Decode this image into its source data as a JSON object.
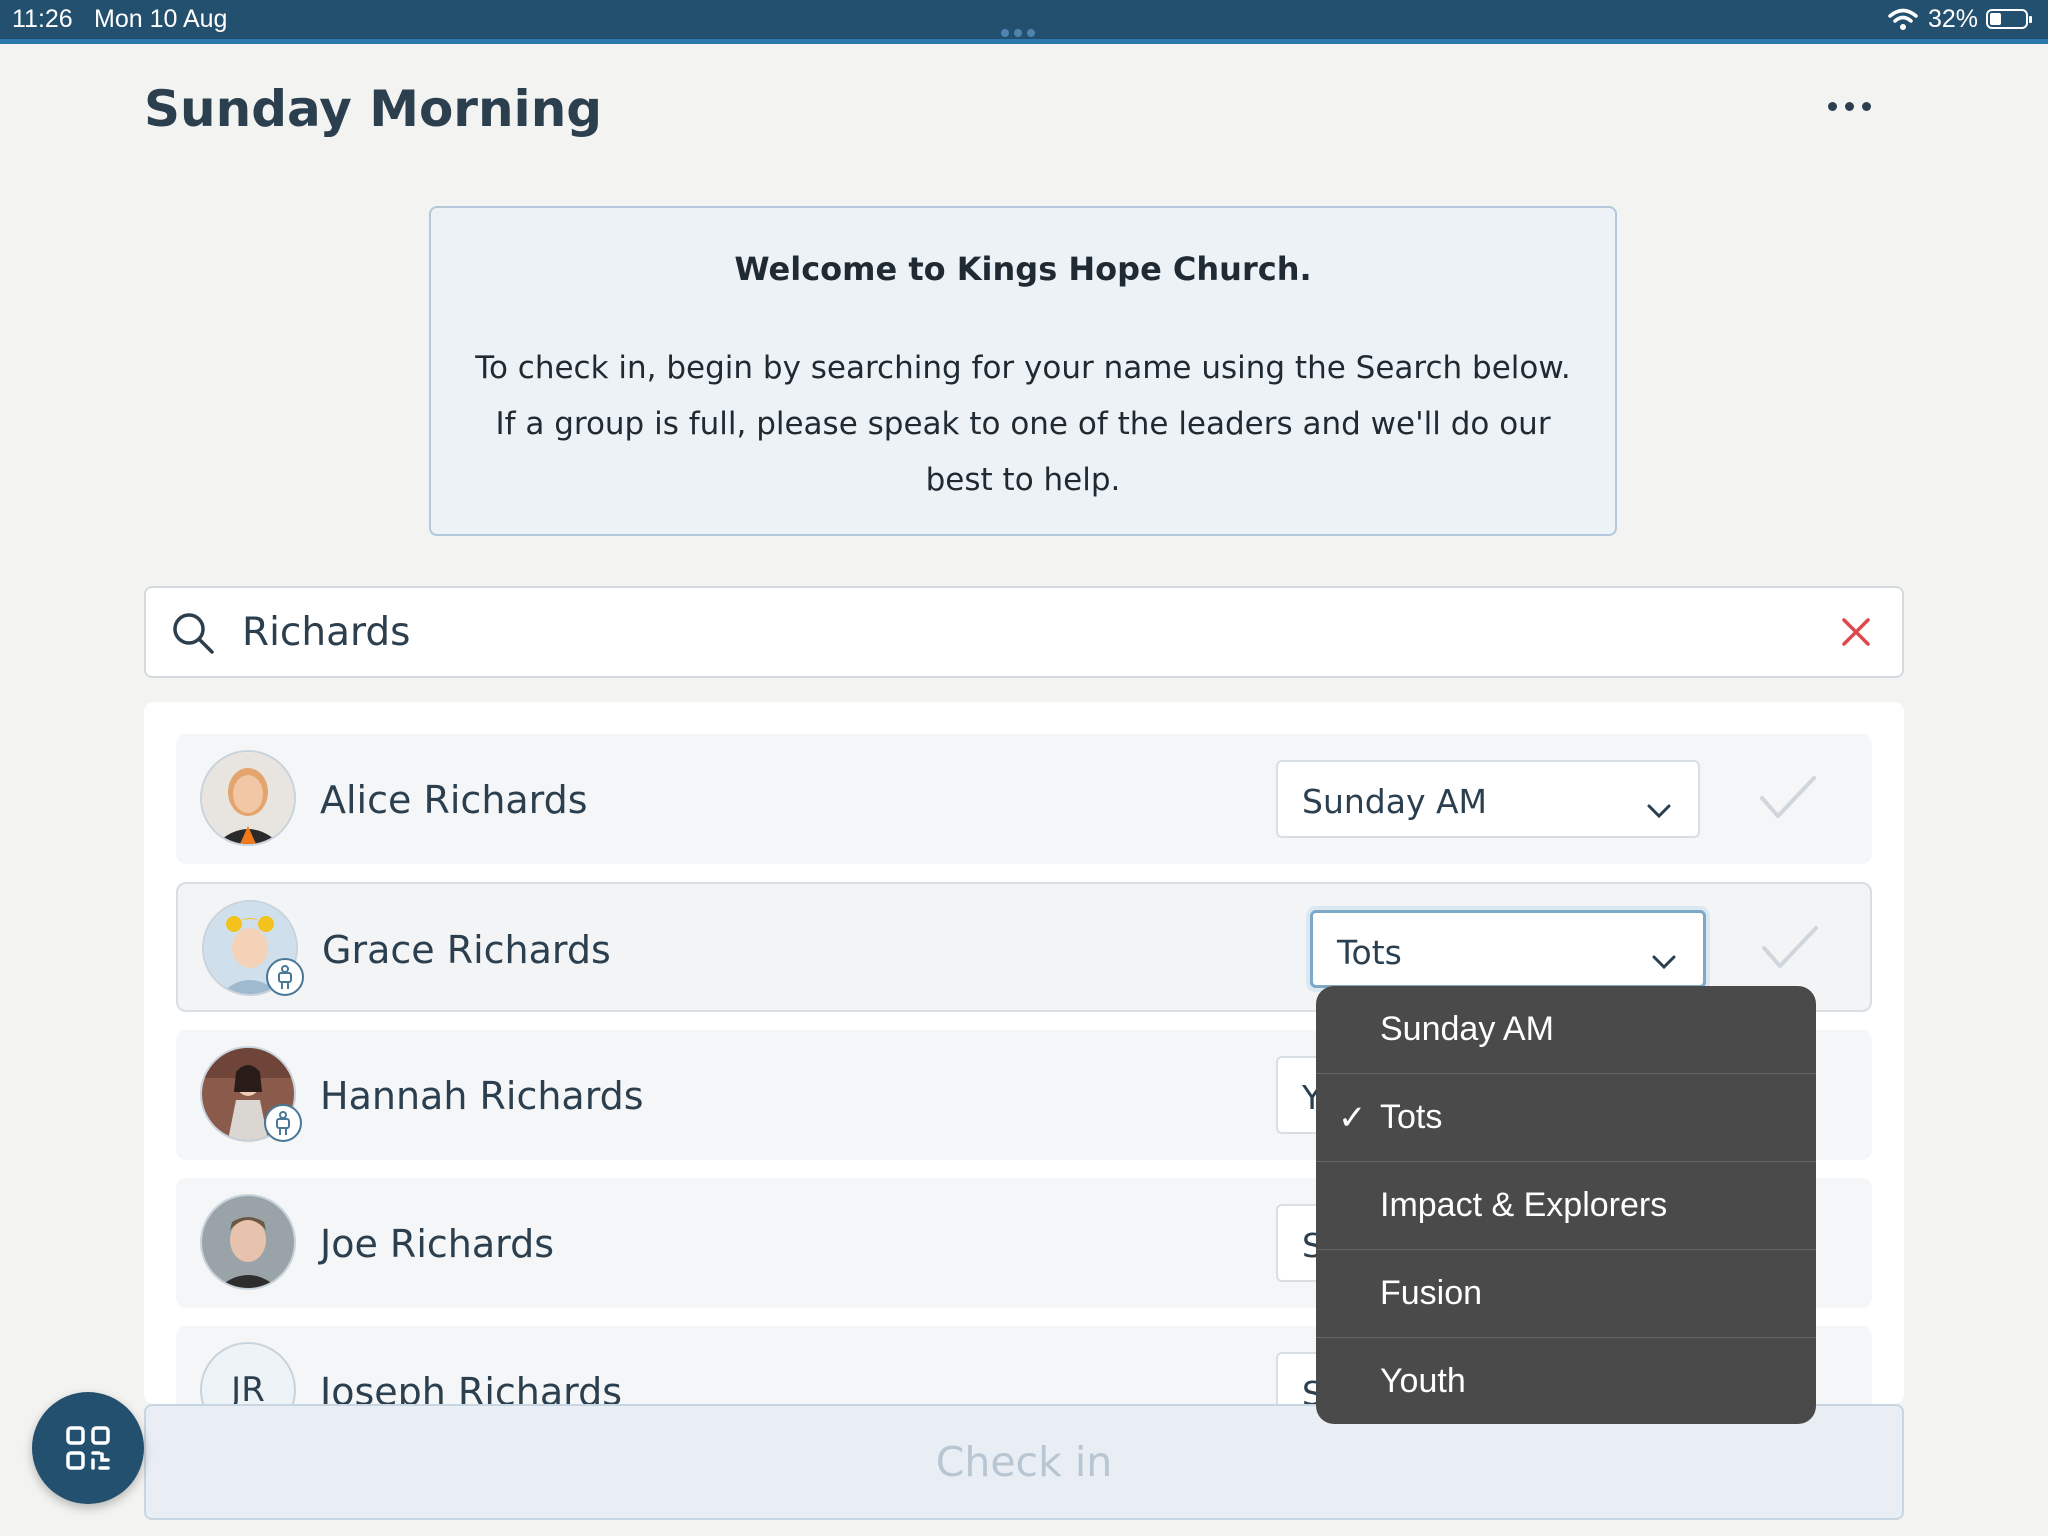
{
  "status_bar": {
    "time": "11:26",
    "date": "Mon 10 Aug",
    "battery": "32%",
    "battery_level": 0.32
  },
  "header": {
    "title": "Sunday Morning",
    "more_icon": "more-horizontal-icon"
  },
  "welcome": {
    "title": "Welcome to Kings Hope Church.",
    "body": "To check in, begin by searching for your name using the Search below. If a group is full, please speak to one of the leaders and we'll do our best to help."
  },
  "search": {
    "value": "Richards",
    "search_icon": "search-icon",
    "clear_icon": "close-icon"
  },
  "people": [
    {
      "name": "Alice Richards",
      "group": "Sunday AM",
      "child": false,
      "initials": ""
    },
    {
      "name": "Grace Richards",
      "group": "Tots",
      "child": true,
      "initials": ""
    },
    {
      "name": "Hannah Richards",
      "group": "Y",
      "child": true,
      "initials": ""
    },
    {
      "name": "Joe Richards",
      "group": "S",
      "child": false,
      "initials": ""
    },
    {
      "name": "Joseph Richards",
      "group": "S",
      "child": false,
      "initials": "JR"
    }
  ],
  "dropdown": {
    "options": [
      "Sunday AM",
      "Tots",
      "Impact & Explorers",
      "Fusion",
      "Youth"
    ],
    "selected": "Tots",
    "check_mark": "✓"
  },
  "footer": {
    "check_in_label": "Check in",
    "qr_icon": "qr-code-icon"
  },
  "colors": {
    "status_bar": "#23506f",
    "accent": "#2d78ad",
    "clear_red": "#e0474c",
    "dropdown_bg": "#4a4a4a"
  }
}
